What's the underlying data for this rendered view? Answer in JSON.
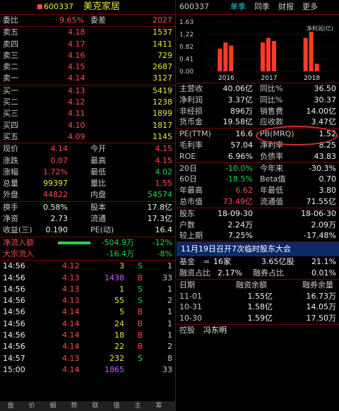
{
  "stock": {
    "code": "600337",
    "name": "美克家居"
  },
  "header_right": {
    "code": "600337",
    "tabs": [
      "单季",
      "同季",
      "财报",
      "更多"
    ]
  },
  "weibi": {
    "label1": "委比",
    "val1": "9.65%",
    "label2": "委差",
    "val2": "2027"
  },
  "sells": [
    {
      "label": "卖五",
      "price": "4.18",
      "vol": "1537"
    },
    {
      "label": "卖四",
      "price": "4.17",
      "vol": "1411"
    },
    {
      "label": "卖三",
      "price": "4.16",
      "vol": "729"
    },
    {
      "label": "卖二",
      "price": "4.15",
      "vol": "2687"
    },
    {
      "label": "卖一",
      "price": "4.14",
      "vol": "3127"
    }
  ],
  "buys": [
    {
      "label": "买一",
      "price": "4.13",
      "vol": "5419"
    },
    {
      "label": "买二",
      "price": "4.12",
      "vol": "1238"
    },
    {
      "label": "买三",
      "price": "4.11",
      "vol": "1899"
    },
    {
      "label": "买四",
      "price": "4.10",
      "vol": "1817"
    },
    {
      "label": "买五",
      "price": "4.09",
      "vol": "1145"
    }
  ],
  "quote": [
    {
      "l1": "现价",
      "v1": "4.14",
      "l2": "今开",
      "v2": "4.15"
    },
    {
      "l1": "涨跌",
      "v1": "0.07",
      "l2": "最高",
      "v2": "4.15"
    },
    {
      "l1": "涨幅",
      "v1": "1.72%",
      "l2": "最低",
      "v2": "4.02"
    },
    {
      "l1": "总量",
      "v1": "99397",
      "l2": "量比",
      "v2": "1.55"
    },
    {
      "l1": "外盘",
      "v1": "44822",
      "l2": "内盘",
      "v2": "54574"
    }
  ],
  "finance": [
    {
      "l1": "换手",
      "v1": "0.58%",
      "l2": "股本",
      "v2": "17.8亿"
    },
    {
      "l1": "净资",
      "v1": "2.73",
      "l2": "流通",
      "v2": "17.3亿"
    },
    {
      "l1": "收益(三)",
      "v1": "0.190",
      "l2": "PE(动)",
      "v2": "16.4"
    }
  ],
  "flows": [
    {
      "label": "净流入额",
      "val": "-504.9万",
      "pct": "-12%"
    },
    {
      "label": "大宗流入",
      "val": "-16.4万",
      "pct": "-8%"
    }
  ],
  "ticks": [
    {
      "time": "14:56",
      "price": "4.12",
      "vol": "3",
      "side": "S",
      "n": "1"
    },
    {
      "time": "14:56",
      "price": "4.13",
      "vol": "1438",
      "side": "B",
      "n": "33"
    },
    {
      "time": "14:56",
      "price": "4.13",
      "vol": "1",
      "side": "S",
      "n": "1"
    },
    {
      "time": "14:56",
      "price": "4.13",
      "vol": "55",
      "side": "S",
      "n": "2"
    },
    {
      "time": "14:56",
      "price": "4.14",
      "vol": "5",
      "side": "B",
      "n": "1"
    },
    {
      "time": "14:56",
      "price": "4.14",
      "vol": "24",
      "side": "B",
      "n": "1"
    },
    {
      "time": "14:56",
      "price": "4.14",
      "vol": "18",
      "side": "B",
      "n": "1"
    },
    {
      "time": "14:56",
      "price": "4.14",
      "vol": "22",
      "side": "B",
      "n": "2"
    },
    {
      "time": "14:57",
      "price": "4.13",
      "vol": "232",
      "side": "S",
      "n": "8"
    },
    {
      "time": "15:00",
      "price": "4.14",
      "vol": "1865",
      "side": "",
      "n": "33"
    }
  ],
  "footer_tabs": [
    "盘",
    "价",
    "细",
    "势",
    "联",
    "值",
    "主",
    "筹"
  ],
  "chart_data": {
    "type": "bar",
    "categories": [
      "2016",
      "2017",
      "2018"
    ],
    "series": [
      {
        "values": [
          0.75,
          0.95,
          1.1
        ]
      },
      {
        "values": [
          0.95,
          1.1,
          1.3
        ]
      },
      {
        "values": [
          0.85,
          1.0,
          0.25
        ]
      }
    ],
    "y_ticks": [
      "1.63",
      "1.22",
      "0.82",
      "0.41",
      "0.00"
    ],
    "legend": "净利润(亿)",
    "ylim": [
      0,
      1.63
    ]
  },
  "fin_rows": [
    {
      "l1": "主营收",
      "v1": "40.06亿",
      "l2": "同比%",
      "v2": "36.50"
    },
    {
      "l1": "净利润",
      "v1": "3.37亿",
      "l2": "同比%",
      "v2": "30.37"
    },
    {
      "l1": "非经损",
      "v1": "896万",
      "l2": "销售费",
      "v2": "14.00亿"
    },
    {
      "l1": "货币金",
      "v1": "19.58亿",
      "l2": "应收款",
      "v2": "3.47亿"
    }
  ],
  "val_rows": [
    {
      "l1": "PE(TTM)",
      "v1": "16.6",
      "l2": "PB(MRQ)",
      "v2": "1.52"
    },
    {
      "l1": "毛利率",
      "v1": "57.04",
      "l2": "净利率",
      "v2": "8.25"
    },
    {
      "l1": "ROE",
      "v1": "6.96%",
      "l2": "负债率",
      "v2": "43.83"
    }
  ],
  "perf_rows": [
    {
      "l1": "20日",
      "v1": "-10.0%",
      "l2": "今年来",
      "v2": "-30.3%"
    },
    {
      "l1": "60日",
      "v1": "-18.5%",
      "l2": "Beta值",
      "v2": "0.70"
    },
    {
      "l1": "年最高",
      "v1": "6.62",
      "l2": "年最低",
      "v2": "3.80"
    },
    {
      "l1": "总市值",
      "v1": "73.49亿",
      "l2": "流通值",
      "v2": "71.55亿"
    }
  ],
  "holder_rows": [
    {
      "l1": "股东",
      "v1": "18-09-30",
      "v2": "18-06-30"
    },
    {
      "l1": "户数",
      "v1": "2.24万",
      "v2": "2.09万"
    },
    {
      "l1": "较上期",
      "v1": "7.25%",
      "v2": "-17.48%"
    }
  ],
  "notice": "11月19日召开7次临时股东大会",
  "fund_row": {
    "l1": "基金",
    "v1": "16家",
    "v2": "3.65亿股",
    "v3": "21.1%"
  },
  "margin_row": {
    "l1": "融资占比",
    "v1": "2.17%",
    "l2": "融券占比",
    "v2": "0.01%"
  },
  "margin_table": {
    "headers": [
      "日期",
      "融资余额",
      "融券余量"
    ],
    "rows": [
      {
        "date": "11-01",
        "bal": "1.55亿",
        "qty": "16.73万"
      },
      {
        "date": "10-31",
        "bal": "1.58亿",
        "qty": "14.05万"
      },
      {
        "date": "10-30",
        "bal": "1.59亿",
        "qty": "17.50万"
      }
    ]
  },
  "controller": {
    "label": "控股",
    "name": "冯东明"
  }
}
